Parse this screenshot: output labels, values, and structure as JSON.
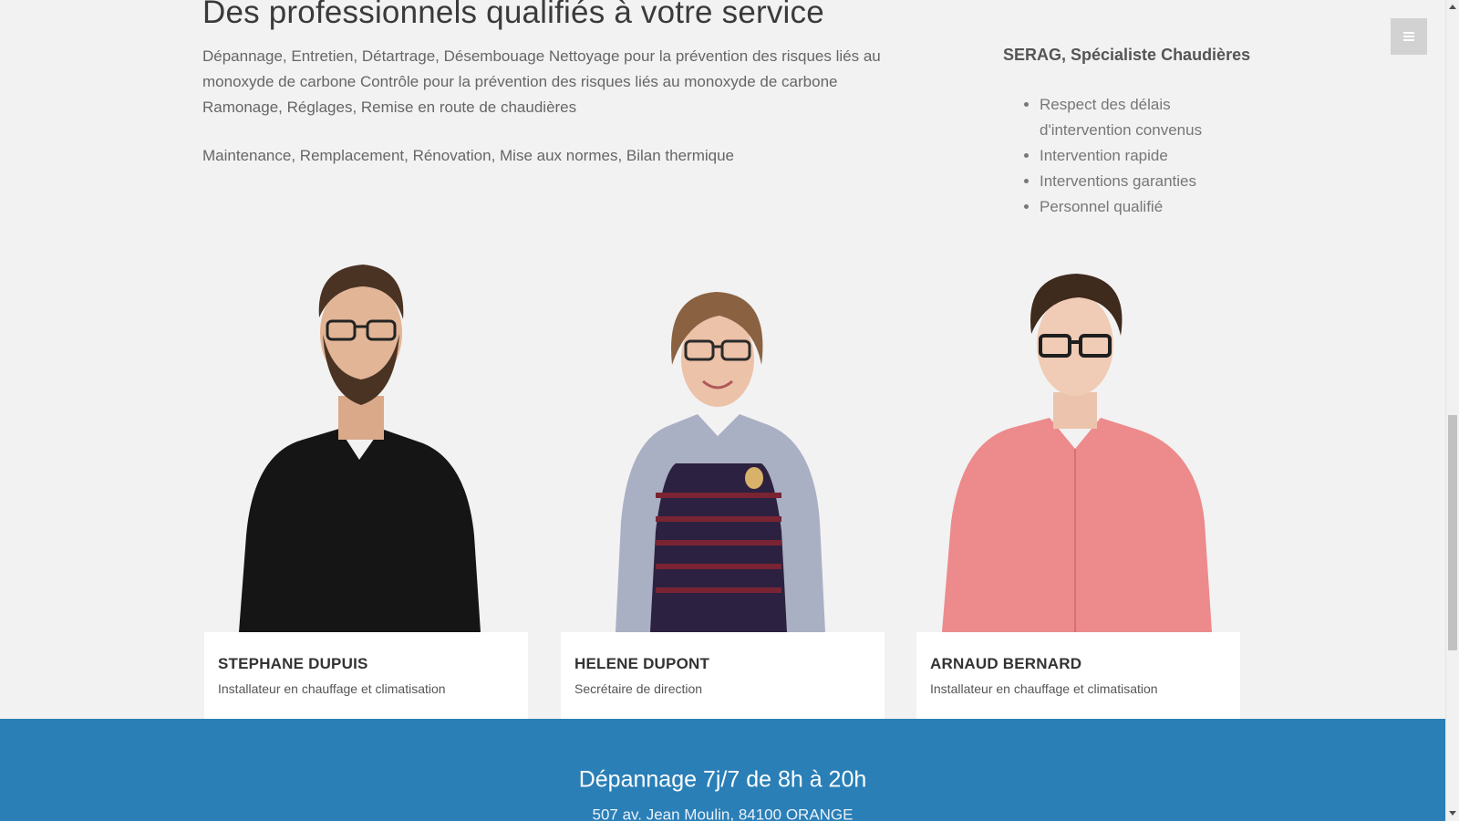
{
  "section": {
    "title": "Des professionnels qualifiés à votre service",
    "intro_paragraphs": [
      "Dépannage, Entretien, Détartrage, Désembouage Nettoyage pour la prévention des risques liés au monoxyde de carbone Contrôle pour la prévention des risques liés au monoxyde de carbone Ramonage, Réglages, Remise en route de chaudières",
      "Maintenance, Remplacement, Rénovation, Mise aux normes, Bilan thermique"
    ]
  },
  "aside": {
    "title": "SERAG, Spécialiste Chaudières",
    "features": [
      "Respect des délais d'intervention convenus",
      "Intervention rapide",
      "Interventions garanties",
      "Personnel qualifié"
    ]
  },
  "menu": {
    "icon": "hamburger-icon"
  },
  "team": [
    {
      "name": "STEPHANE DUPUIS",
      "role": "Installateur en chauffage et climatisation",
      "shirt_color": "#151515"
    },
    {
      "name": "HELENE DUPONT",
      "role": "Secrétaire de direction",
      "shirt_color": "#2c2140"
    },
    {
      "name": "ARNAUD BERNARD",
      "role": "Installateur en chauffage et climatisation",
      "shirt_color": "#ec8a8c"
    }
  ],
  "footer": {
    "title": "Dépannage 7j/7 de 8h à 20h",
    "address": "507 av. Jean Moulin, 84100 ORANGE",
    "background": "#2a7fb7"
  },
  "colors": {
    "accent": "#2a7fb7",
    "page_background": "#f2f2f2",
    "card_background": "#ffffff"
  }
}
